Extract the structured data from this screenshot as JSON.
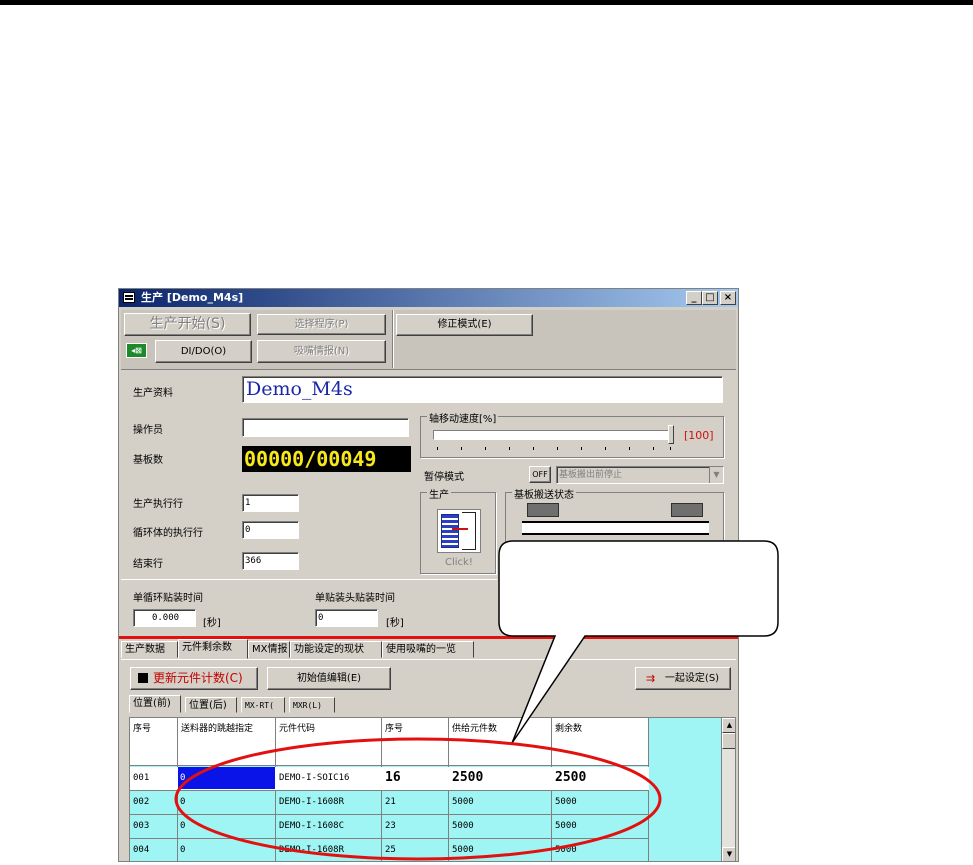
{
  "window": {
    "title": "生产 [Demo_M4s]",
    "min": "_",
    "max": "□",
    "close": "×"
  },
  "toolbar": {
    "start_label": "生产开始(S)",
    "select_program_label": "选择程序(P)",
    "correct_mode_label": "修正模式(E)",
    "dido_label": "DI/DO(O)",
    "nozzle_info_label": "吸嘴情报(N)"
  },
  "form": {
    "prod_data_label": "生产资料",
    "prod_data_value": "Demo_M4s",
    "operator_label": "操作员",
    "operator_value": "",
    "board_count_label": "基板数",
    "board_count_value": "00000/00049",
    "exec_row_label": "生产执行行",
    "exec_row_value": "1",
    "loop_exec_row_label": "循环体的执行行",
    "loop_exec_row_value": "0",
    "end_row_label": "结束行",
    "end_row_value": "366",
    "cycle_time_label": "单循环贴装时间",
    "cycle_time_value": "0.000",
    "cycle_time_unit": "[秒]",
    "head_time_label": "单贴装头贴装时间",
    "head_time_value": "0",
    "head_time_unit": "[秒]"
  },
  "axis_speed": {
    "label": "轴移动速度[%]",
    "value_text": "[100]",
    "value": 100
  },
  "pause_mode": {
    "label": "暂停模式",
    "toggle": "OFF",
    "select_value": "基板搬出前停止"
  },
  "production_group": {
    "title": "生产",
    "click_label": "Click!"
  },
  "transfer_group": {
    "title": "基板搬送状态"
  },
  "tabs": [
    "生产数据",
    "元件剩余数",
    "MX情报",
    "功能设定的现状",
    "使用吸嘴的一览"
  ],
  "panel": {
    "update_label": "更新元件计数(C)",
    "init_edit_label": "初始值编辑(E)",
    "batch_set_label": "一起设定(S)"
  },
  "subtabs": [
    "位置(前)",
    "位置(后)",
    "MX-RT(",
    "MXR(L)"
  ],
  "table": {
    "headers": [
      "序号",
      "送料器的跳越指定",
      "元件代码",
      "序号",
      "供给元件数",
      "剩余数"
    ],
    "rows": [
      [
        "001",
        "0",
        "DEMO-I-SOIC16",
        "16",
        "2500",
        "2500"
      ],
      [
        "002",
        "0",
        "DEMO-I-1608R",
        "21",
        "5000",
        "5000"
      ],
      [
        "003",
        "0",
        "DEMO-I-1608C",
        "23",
        "5000",
        "5000"
      ],
      [
        "004",
        "0",
        "DEMO-I-1608R",
        "25",
        "5000",
        "5000"
      ]
    ]
  },
  "colors": {
    "title_bar": "#0a246a",
    "grid_bg": "#9ff5f4",
    "counter_text": "#f7e81a",
    "name_text": "#1a27a8",
    "annotation": "#e31010"
  }
}
